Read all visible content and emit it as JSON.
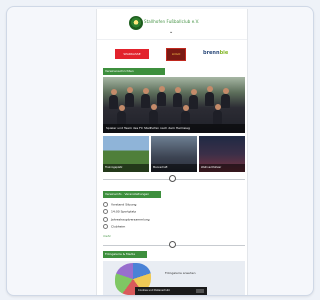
{
  "header": {
    "site_title": "Stallhofen Fußballclub e.V."
  },
  "sponsors": [
    "SPARKASSE",
    "LOGO",
    "brenn",
    "bie"
  ],
  "sections": {
    "news_title": "Vereinsnachrichten",
    "events_title": "Vereinsinfo · Veranstaltungen",
    "gallery_title": "Fotogalerie & Media"
  },
  "hero": {
    "caption": "Spieler und Team des FC Stallhofen nach dem Heimsieg"
  },
  "thumbs": [
    {
      "caption": "Trainingsplatz"
    },
    {
      "caption": "Mannschaft"
    },
    {
      "caption": "Weihnachtsfeier"
    }
  ],
  "events": [
    {
      "text": "Vorstand Sitzung"
    },
    {
      "text": "14:00 Sportplatz"
    },
    {
      "text": "Jahreshauptversammlung"
    },
    {
      "text": "Clubheim"
    }
  ],
  "more_link": "mehr",
  "bottom": {
    "text": "Fotogalerie ansehen"
  },
  "cookie": {
    "text": "Cookies und Datenschutz"
  },
  "icons": {
    "logo": "club-crest-icon",
    "menu": "chevron-down-icon",
    "divider": "soccer-ball-icon"
  },
  "colors": {
    "accent": "#3d8f3d",
    "sponsor_red": "#e2222c"
  }
}
